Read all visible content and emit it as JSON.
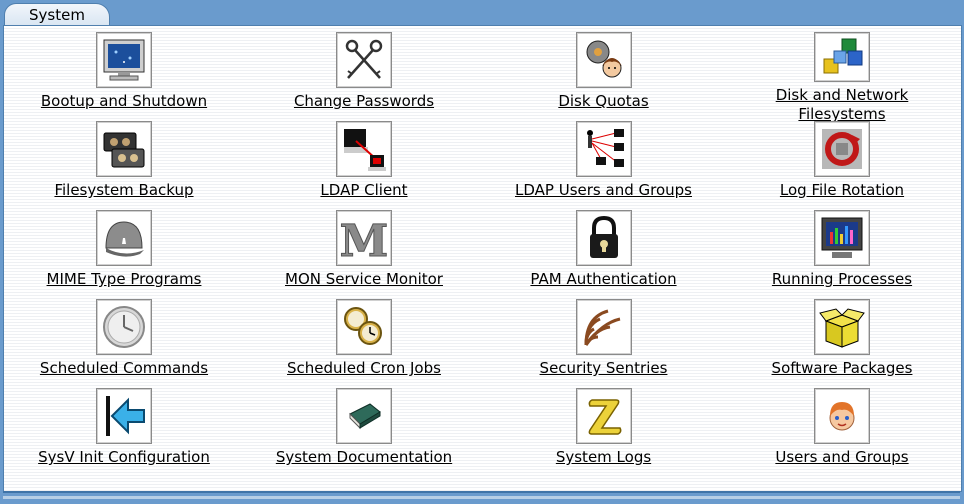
{
  "tab": {
    "label": "System"
  },
  "modules": [
    {
      "label": "Bootup and Shutdown",
      "icon": "monitor-icon"
    },
    {
      "label": "Change Passwords",
      "icon": "keys-icon"
    },
    {
      "label": "Disk Quotas",
      "icon": "disk-user-icon"
    },
    {
      "label": "Disk and Network Filesystems",
      "icon": "cubes-icon"
    },
    {
      "label": "Filesystem Backup",
      "icon": "tape-icon"
    },
    {
      "label": "LDAP Client",
      "icon": "ldap-client-icon"
    },
    {
      "label": "LDAP Users and Groups",
      "icon": "network-users-icon"
    },
    {
      "label": "Log File Rotation",
      "icon": "rotation-icon"
    },
    {
      "label": "MIME Type Programs",
      "icon": "cap-icon"
    },
    {
      "label": "MON Service Monitor",
      "icon": "letter-m-icon"
    },
    {
      "label": "PAM Authentication",
      "icon": "padlock-icon"
    },
    {
      "label": "Running Processes",
      "icon": "process-monitor-icon"
    },
    {
      "label": "Scheduled Commands",
      "icon": "clock-icon"
    },
    {
      "label": "Scheduled Cron Jobs",
      "icon": "clocks-icon"
    },
    {
      "label": "Security Sentries",
      "icon": "radar-icon"
    },
    {
      "label": "Software Packages",
      "icon": "box-icon"
    },
    {
      "label": "SysV Init Configuration",
      "icon": "back-arrow-icon"
    },
    {
      "label": "System Documentation",
      "icon": "book-icon"
    },
    {
      "label": "System Logs",
      "icon": "scroll-icon"
    },
    {
      "label": "Users and Groups",
      "icon": "user-face-icon"
    }
  ]
}
